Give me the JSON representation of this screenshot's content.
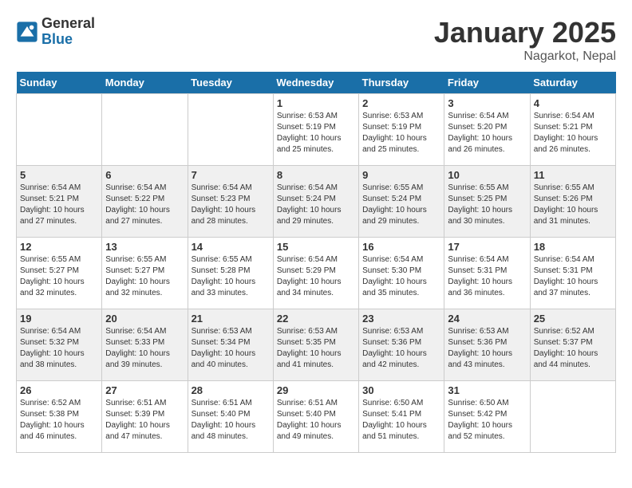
{
  "header": {
    "logo_general": "General",
    "logo_blue": "Blue",
    "month_title": "January 2025",
    "location": "Nagarkot, Nepal"
  },
  "weekdays": [
    "Sunday",
    "Monday",
    "Tuesday",
    "Wednesday",
    "Thursday",
    "Friday",
    "Saturday"
  ],
  "weeks": [
    [
      {
        "day": "",
        "sunrise": "",
        "sunset": "",
        "daylight": ""
      },
      {
        "day": "",
        "sunrise": "",
        "sunset": "",
        "daylight": ""
      },
      {
        "day": "",
        "sunrise": "",
        "sunset": "",
        "daylight": ""
      },
      {
        "day": "1",
        "sunrise": "Sunrise: 6:53 AM",
        "sunset": "Sunset: 5:19 PM",
        "daylight": "Daylight: 10 hours and 25 minutes."
      },
      {
        "day": "2",
        "sunrise": "Sunrise: 6:53 AM",
        "sunset": "Sunset: 5:19 PM",
        "daylight": "Daylight: 10 hours and 25 minutes."
      },
      {
        "day": "3",
        "sunrise": "Sunrise: 6:54 AM",
        "sunset": "Sunset: 5:20 PM",
        "daylight": "Daylight: 10 hours and 26 minutes."
      },
      {
        "day": "4",
        "sunrise": "Sunrise: 6:54 AM",
        "sunset": "Sunset: 5:21 PM",
        "daylight": "Daylight: 10 hours and 26 minutes."
      }
    ],
    [
      {
        "day": "5",
        "sunrise": "Sunrise: 6:54 AM",
        "sunset": "Sunset: 5:21 PM",
        "daylight": "Daylight: 10 hours and 27 minutes."
      },
      {
        "day": "6",
        "sunrise": "Sunrise: 6:54 AM",
        "sunset": "Sunset: 5:22 PM",
        "daylight": "Daylight: 10 hours and 27 minutes."
      },
      {
        "day": "7",
        "sunrise": "Sunrise: 6:54 AM",
        "sunset": "Sunset: 5:23 PM",
        "daylight": "Daylight: 10 hours and 28 minutes."
      },
      {
        "day": "8",
        "sunrise": "Sunrise: 6:54 AM",
        "sunset": "Sunset: 5:24 PM",
        "daylight": "Daylight: 10 hours and 29 minutes."
      },
      {
        "day": "9",
        "sunrise": "Sunrise: 6:55 AM",
        "sunset": "Sunset: 5:24 PM",
        "daylight": "Daylight: 10 hours and 29 minutes."
      },
      {
        "day": "10",
        "sunrise": "Sunrise: 6:55 AM",
        "sunset": "Sunset: 5:25 PM",
        "daylight": "Daylight: 10 hours and 30 minutes."
      },
      {
        "day": "11",
        "sunrise": "Sunrise: 6:55 AM",
        "sunset": "Sunset: 5:26 PM",
        "daylight": "Daylight: 10 hours and 31 minutes."
      }
    ],
    [
      {
        "day": "12",
        "sunrise": "Sunrise: 6:55 AM",
        "sunset": "Sunset: 5:27 PM",
        "daylight": "Daylight: 10 hours and 32 minutes."
      },
      {
        "day": "13",
        "sunrise": "Sunrise: 6:55 AM",
        "sunset": "Sunset: 5:27 PM",
        "daylight": "Daylight: 10 hours and 32 minutes."
      },
      {
        "day": "14",
        "sunrise": "Sunrise: 6:55 AM",
        "sunset": "Sunset: 5:28 PM",
        "daylight": "Daylight: 10 hours and 33 minutes."
      },
      {
        "day": "15",
        "sunrise": "Sunrise: 6:54 AM",
        "sunset": "Sunset: 5:29 PM",
        "daylight": "Daylight: 10 hours and 34 minutes."
      },
      {
        "day": "16",
        "sunrise": "Sunrise: 6:54 AM",
        "sunset": "Sunset: 5:30 PM",
        "daylight": "Daylight: 10 hours and 35 minutes."
      },
      {
        "day": "17",
        "sunrise": "Sunrise: 6:54 AM",
        "sunset": "Sunset: 5:31 PM",
        "daylight": "Daylight: 10 hours and 36 minutes."
      },
      {
        "day": "18",
        "sunrise": "Sunrise: 6:54 AM",
        "sunset": "Sunset: 5:31 PM",
        "daylight": "Daylight: 10 hours and 37 minutes."
      }
    ],
    [
      {
        "day": "19",
        "sunrise": "Sunrise: 6:54 AM",
        "sunset": "Sunset: 5:32 PM",
        "daylight": "Daylight: 10 hours and 38 minutes."
      },
      {
        "day": "20",
        "sunrise": "Sunrise: 6:54 AM",
        "sunset": "Sunset: 5:33 PM",
        "daylight": "Daylight: 10 hours and 39 minutes."
      },
      {
        "day": "21",
        "sunrise": "Sunrise: 6:53 AM",
        "sunset": "Sunset: 5:34 PM",
        "daylight": "Daylight: 10 hours and 40 minutes."
      },
      {
        "day": "22",
        "sunrise": "Sunrise: 6:53 AM",
        "sunset": "Sunset: 5:35 PM",
        "daylight": "Daylight: 10 hours and 41 minutes."
      },
      {
        "day": "23",
        "sunrise": "Sunrise: 6:53 AM",
        "sunset": "Sunset: 5:36 PM",
        "daylight": "Daylight: 10 hours and 42 minutes."
      },
      {
        "day": "24",
        "sunrise": "Sunrise: 6:53 AM",
        "sunset": "Sunset: 5:36 PM",
        "daylight": "Daylight: 10 hours and 43 minutes."
      },
      {
        "day": "25",
        "sunrise": "Sunrise: 6:52 AM",
        "sunset": "Sunset: 5:37 PM",
        "daylight": "Daylight: 10 hours and 44 minutes."
      }
    ],
    [
      {
        "day": "26",
        "sunrise": "Sunrise: 6:52 AM",
        "sunset": "Sunset: 5:38 PM",
        "daylight": "Daylight: 10 hours and 46 minutes."
      },
      {
        "day": "27",
        "sunrise": "Sunrise: 6:51 AM",
        "sunset": "Sunset: 5:39 PM",
        "daylight": "Daylight: 10 hours and 47 minutes."
      },
      {
        "day": "28",
        "sunrise": "Sunrise: 6:51 AM",
        "sunset": "Sunset: 5:40 PM",
        "daylight": "Daylight: 10 hours and 48 minutes."
      },
      {
        "day": "29",
        "sunrise": "Sunrise: 6:51 AM",
        "sunset": "Sunset: 5:40 PM",
        "daylight": "Daylight: 10 hours and 49 minutes."
      },
      {
        "day": "30",
        "sunrise": "Sunrise: 6:50 AM",
        "sunset": "Sunset: 5:41 PM",
        "daylight": "Daylight: 10 hours and 51 minutes."
      },
      {
        "day": "31",
        "sunrise": "Sunrise: 6:50 AM",
        "sunset": "Sunset: 5:42 PM",
        "daylight": "Daylight: 10 hours and 52 minutes."
      },
      {
        "day": "",
        "sunrise": "",
        "sunset": "",
        "daylight": ""
      }
    ]
  ]
}
